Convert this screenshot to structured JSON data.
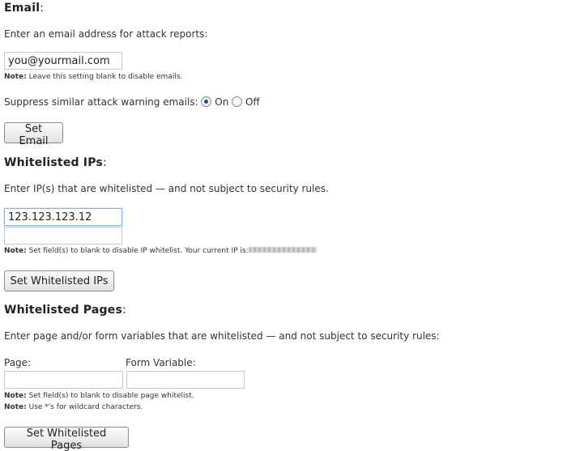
{
  "email": {
    "heading": "Email",
    "description": "Enter an email address for attack reports:",
    "value": "you@yourmail.com",
    "note_label": "Note:",
    "note_text": "Leave this setting blank to disable emails.",
    "suppress_label": "Suppress similar attack warning emails:",
    "suppress_on": "On",
    "suppress_off": "Off",
    "suppress_selected": "On",
    "button": "Set Email"
  },
  "whitelisted_ips": {
    "heading": "Whitelisted IPs",
    "description": "Enter IP(s) that are whitelisted — and not subject to security rules.",
    "values": [
      "123.123.123.12",
      ""
    ],
    "note_label": "Note:",
    "note_text": "Set field(s) to blank to disable IP whitelist. Your current IP is:",
    "button": "Set Whitelisted IPs"
  },
  "whitelisted_pages": {
    "heading": "Whitelisted Pages",
    "description": "Enter page and/or form variables that are whitelisted — and not subject to security rules:",
    "page_label": "Page:",
    "form_variable_label": "Form Variable:",
    "page_value": "",
    "form_variable_value": "",
    "note1_label": "Note:",
    "note1_text": "Set field(s) to blank to disable page whitelist.",
    "note2_label": "Note:",
    "note2_text": "Use *'s for wildcard characters.",
    "button": "Set Whitelisted Pages"
  }
}
